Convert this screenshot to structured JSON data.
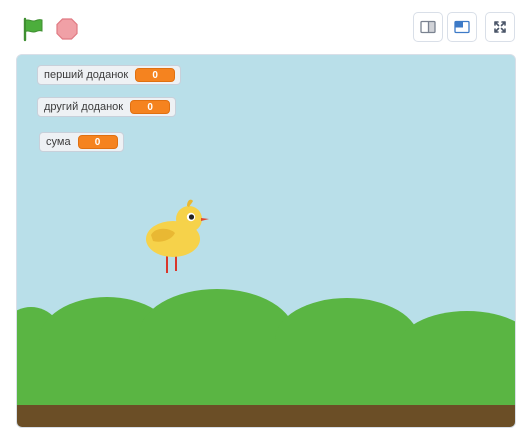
{
  "toolbar": {
    "icons": {
      "green_flag": "green-flag-icon",
      "stop": "stop-sign-icon",
      "small_stage": "small-stage-icon",
      "normal_stage": "normal-stage-icon",
      "fullscreen": "fullscreen-icon"
    },
    "colors": {
      "flag": "#4cae3c",
      "stop": "#f0a0a6",
      "button_accent": "#3d7ac7"
    }
  },
  "stage": {
    "colors": {
      "sky": "#b9dfe9",
      "hills": "#5ab543",
      "ground": "#6b4e26"
    },
    "monitors": [
      {
        "label": "перший доданок",
        "value": "0"
      },
      {
        "label": "другий доданок",
        "value": "0"
      },
      {
        "label": "сума",
        "value": "0"
      }
    ],
    "sprite": "yellow-chick"
  }
}
